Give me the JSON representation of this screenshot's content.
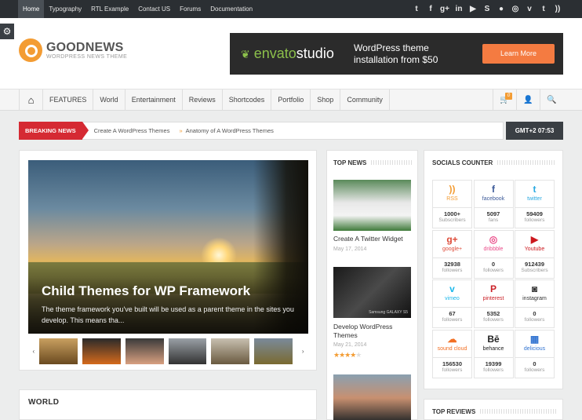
{
  "topbar": {
    "nav": [
      "Home",
      "Typography",
      "RTL Example",
      "Contact US",
      "Forums",
      "Documentation"
    ],
    "social_icons": [
      {
        "name": "twitter-icon",
        "glyph": "t"
      },
      {
        "name": "facebook-icon",
        "glyph": "f"
      },
      {
        "name": "google-plus-icon",
        "glyph": "g+"
      },
      {
        "name": "linkedin-icon",
        "glyph": "in"
      },
      {
        "name": "youtube-icon",
        "glyph": "▶"
      },
      {
        "name": "skype-icon",
        "glyph": "S"
      },
      {
        "name": "flickr-icon",
        "glyph": "●"
      },
      {
        "name": "dribbble-icon",
        "glyph": "◎"
      },
      {
        "name": "vimeo-icon",
        "glyph": "v"
      },
      {
        "name": "tumblr-icon",
        "glyph": "t"
      },
      {
        "name": "rss-icon",
        "glyph": "))"
      }
    ]
  },
  "header": {
    "logo_name": "GOODNEWS",
    "logo_tagline": "WORDPRESS NEWS THEME",
    "banner": {
      "brand_pre": "envato",
      "brand_post": "studio",
      "text": "WordPress theme installation from $50",
      "button": "Learn More"
    }
  },
  "mainnav": {
    "items": [
      "FEATURES",
      "World",
      "Entertainment",
      "Reviews",
      "Shortcodes",
      "Portfolio",
      "Shop",
      "Community"
    ],
    "cart_count": "0"
  },
  "breaking": {
    "label": "BREAKING NEWS",
    "items": [
      "Create A WordPress Themes",
      "Anatomy of A WordPress Themes"
    ],
    "clock": "GMT+2 07:53"
  },
  "featured": {
    "title": "Child Themes for WP Framework",
    "excerpt": "The theme framework you've built will be used as a parent theme in the sites you develop. This means tha..."
  },
  "world": {
    "title": "WORLD"
  },
  "topnews": {
    "title": "TOP NEWS",
    "items": [
      {
        "title": "Create A Twitter Widget",
        "date": "May 17, 2014"
      },
      {
        "title": "Develop WordPress Themes",
        "date": "May 21, 2014",
        "rating": 4
      }
    ],
    "phone_label": "Samsung GALAXY S5"
  },
  "socials": {
    "title": "SOCIALS COUNTER",
    "counters": [
      {
        "name": "RSS",
        "glyph": "))",
        "color": "#f39c33",
        "count": "1000+",
        "label": "Subscribers"
      },
      {
        "name": "facebook",
        "glyph": "f",
        "color": "#3b5998",
        "count": "5097",
        "label": "fans"
      },
      {
        "name": "twitter",
        "glyph": "t",
        "color": "#29a9e1",
        "count": "59409",
        "label": "followers"
      },
      {
        "name": "google+",
        "glyph": "g+",
        "color": "#dd4b39",
        "count": "32938",
        "label": "followers"
      },
      {
        "name": "dribbble",
        "glyph": "◎",
        "color": "#ea4c89",
        "count": "0",
        "label": "followers"
      },
      {
        "name": "Youtube",
        "glyph": "▶",
        "color": "#cc181e",
        "count": "912439",
        "label": "Subscribers"
      },
      {
        "name": "vimeo",
        "glyph": "v",
        "color": "#1ab7ea",
        "count": "67",
        "label": "followers"
      },
      {
        "name": "pinterest",
        "glyph": "P",
        "color": "#cb2027",
        "count": "5352",
        "label": "followers"
      },
      {
        "name": "instagram",
        "glyph": "◙",
        "color": "#333333",
        "count": "0",
        "label": "followers"
      },
      {
        "name": "sound cloud",
        "glyph": "☁",
        "color": "#f26f23",
        "count": "156530",
        "label": "followers"
      },
      {
        "name": "behance",
        "glyph": "Bē",
        "color": "#222222",
        "count": "19399",
        "label": "followers"
      },
      {
        "name": "delicious",
        "glyph": "▦",
        "color": "#3274d1",
        "count": "0",
        "label": "followers"
      }
    ]
  },
  "topreviews": {
    "title": "TOP REVIEWS"
  }
}
